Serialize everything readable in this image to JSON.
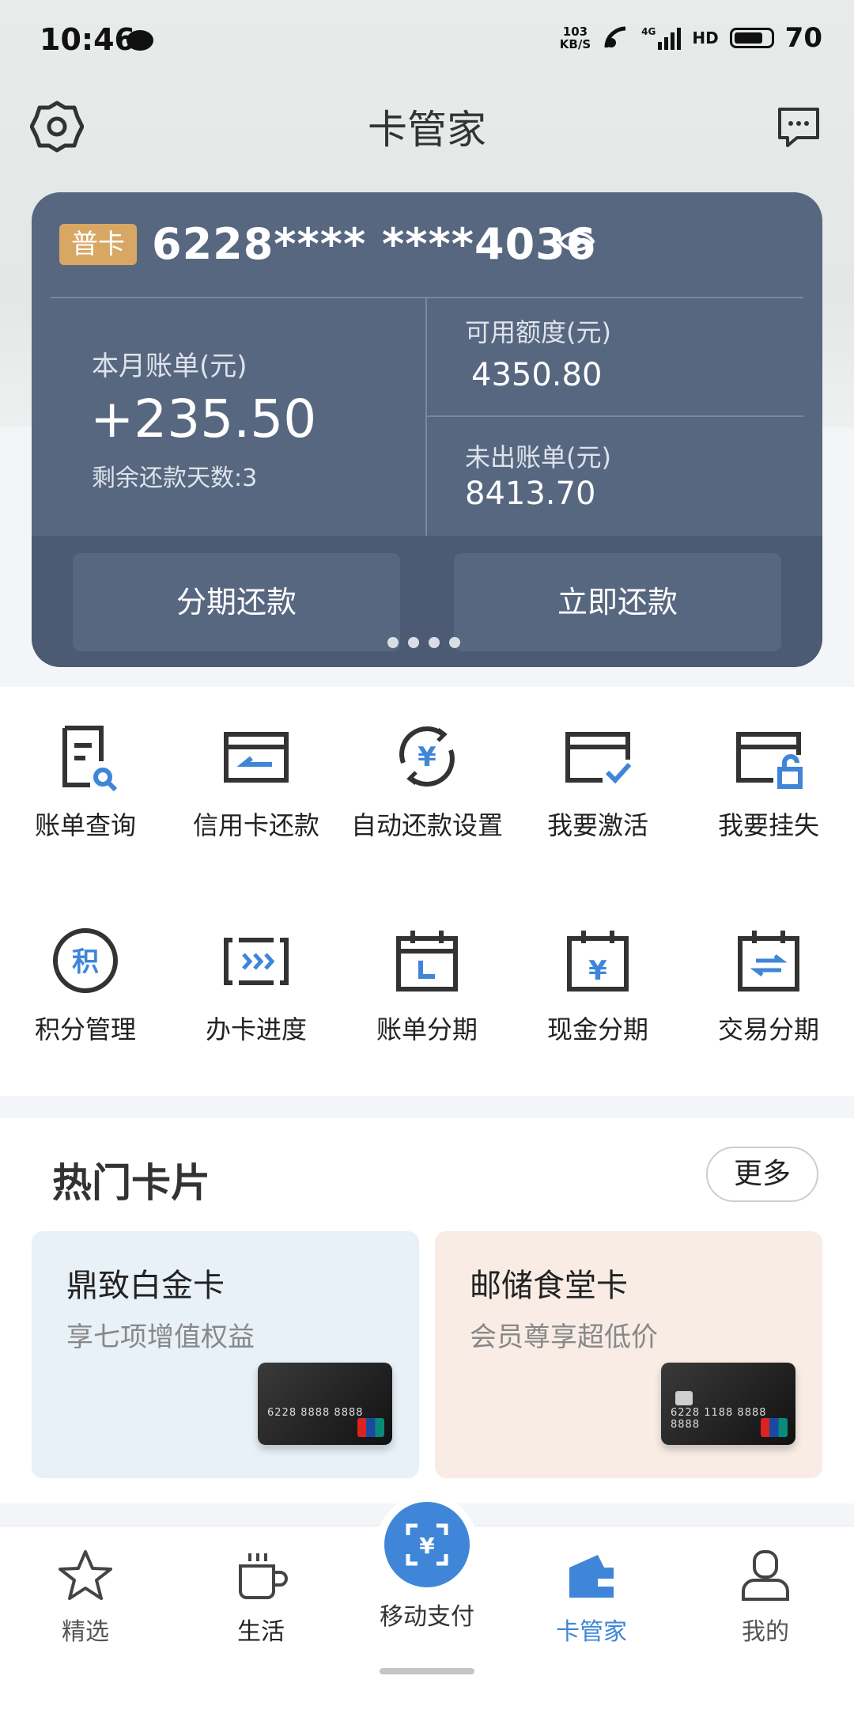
{
  "status_bar": {
    "time": "10:46",
    "speed_value": "103",
    "speed_unit": "KB/S",
    "network": "4G",
    "hd": "HD",
    "battery": "70"
  },
  "header": {
    "title": "卡管家"
  },
  "card": {
    "badge": "普卡",
    "number": "6228**** ****4036",
    "monthly_bill_label": "本月账单(元)",
    "monthly_bill_value": "+235.50",
    "days_left": "剩余还款天数:3",
    "available_label": "可用额度(元)",
    "available_value": "4350.80",
    "unbilled_label": "未出账单(元)",
    "unbilled_value": "8413.70",
    "installment_button": "分期还款",
    "repay_button": "立即还款"
  },
  "services": [
    {
      "label": "账单查询",
      "icon": "bill-search-icon"
    },
    {
      "label": "信用卡还款",
      "icon": "card-repay-icon"
    },
    {
      "label": "自动还款设置",
      "icon": "auto-repay-icon"
    },
    {
      "label": "我要激活",
      "icon": "card-activate-icon"
    },
    {
      "label": "我要挂失",
      "icon": "card-lock-icon"
    },
    {
      "label": "积分管理",
      "icon": "points-icon"
    },
    {
      "label": "办卡进度",
      "icon": "progress-icon"
    },
    {
      "label": "账单分期",
      "icon": "bill-installment-icon"
    },
    {
      "label": "现金分期",
      "icon": "cash-installment-icon"
    },
    {
      "label": "交易分期",
      "icon": "trade-installment-icon"
    }
  ],
  "hot_cards": {
    "title": "热门卡片",
    "more": "更多",
    "items": [
      {
        "name": "鼎致白金卡",
        "subtitle": "享七项增值权益",
        "card_number_text": "6228 8888 8888"
      },
      {
        "name": "邮储食堂卡",
        "subtitle": "会员尊享超低价",
        "card_number_text": "6228 1188 8888 8888"
      }
    ]
  },
  "tabbar": {
    "items": [
      {
        "label": "精选",
        "icon": "star-icon"
      },
      {
        "label": "生活",
        "icon": "cup-icon"
      },
      {
        "label": "移动支付",
        "icon": "scan-pay-icon"
      },
      {
        "label": "卡管家",
        "icon": "wallet-icon",
        "active": true
      },
      {
        "label": "我的",
        "icon": "user-icon"
      }
    ]
  },
  "colors": {
    "card_bg": "#586780",
    "accent": "#3f86d8",
    "badge": "#d9a764"
  }
}
